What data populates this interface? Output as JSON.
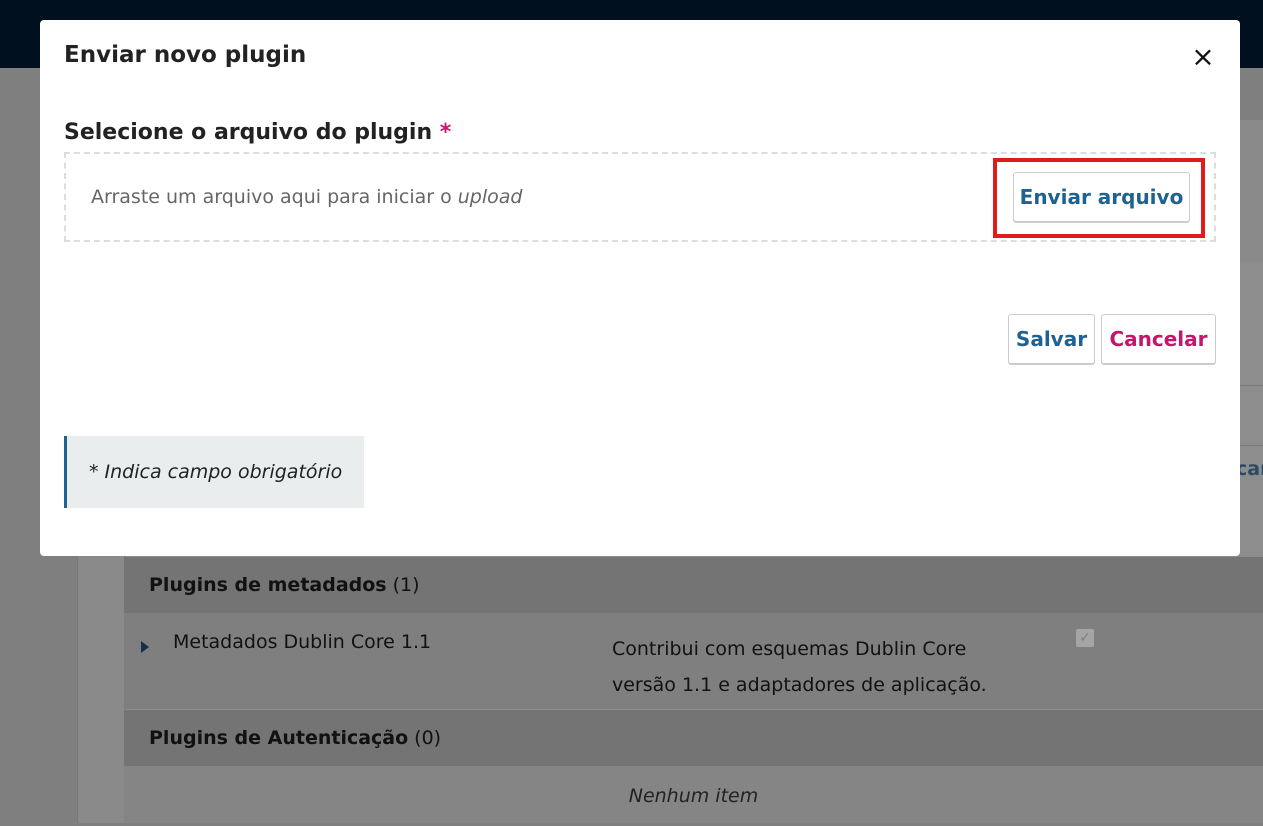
{
  "background": {
    "cutoff_text": "car",
    "groups": [
      {
        "title": "Plugins de metadados",
        "count": "(1)",
        "rows": [
          {
            "name": "Metadados Dublin Core 1.1",
            "description": "Contribui com esquemas Dublin Core versão 1.1 e adaptadores de aplicação."
          }
        ]
      },
      {
        "title": "Plugins de Autenticação",
        "count": "(0)",
        "empty_text": "Nenhum item"
      }
    ]
  },
  "modal": {
    "title": "Enviar novo plugin",
    "close_symbol": "×",
    "field_label": "Selecione o arquivo do plugin",
    "required_mark": "*",
    "dropzone_text": "Arraste um arquivo aqui para iniciar o ",
    "dropzone_text_em": "upload",
    "upload_button": "Enviar arquivo",
    "save_button": "Salvar",
    "cancel_button": "Cancelar",
    "required_notice": "* Indica campo obrigatório"
  },
  "colors": {
    "primary": "#1e6292",
    "accent": "#c4166d",
    "highlight": "#e01b1b"
  }
}
